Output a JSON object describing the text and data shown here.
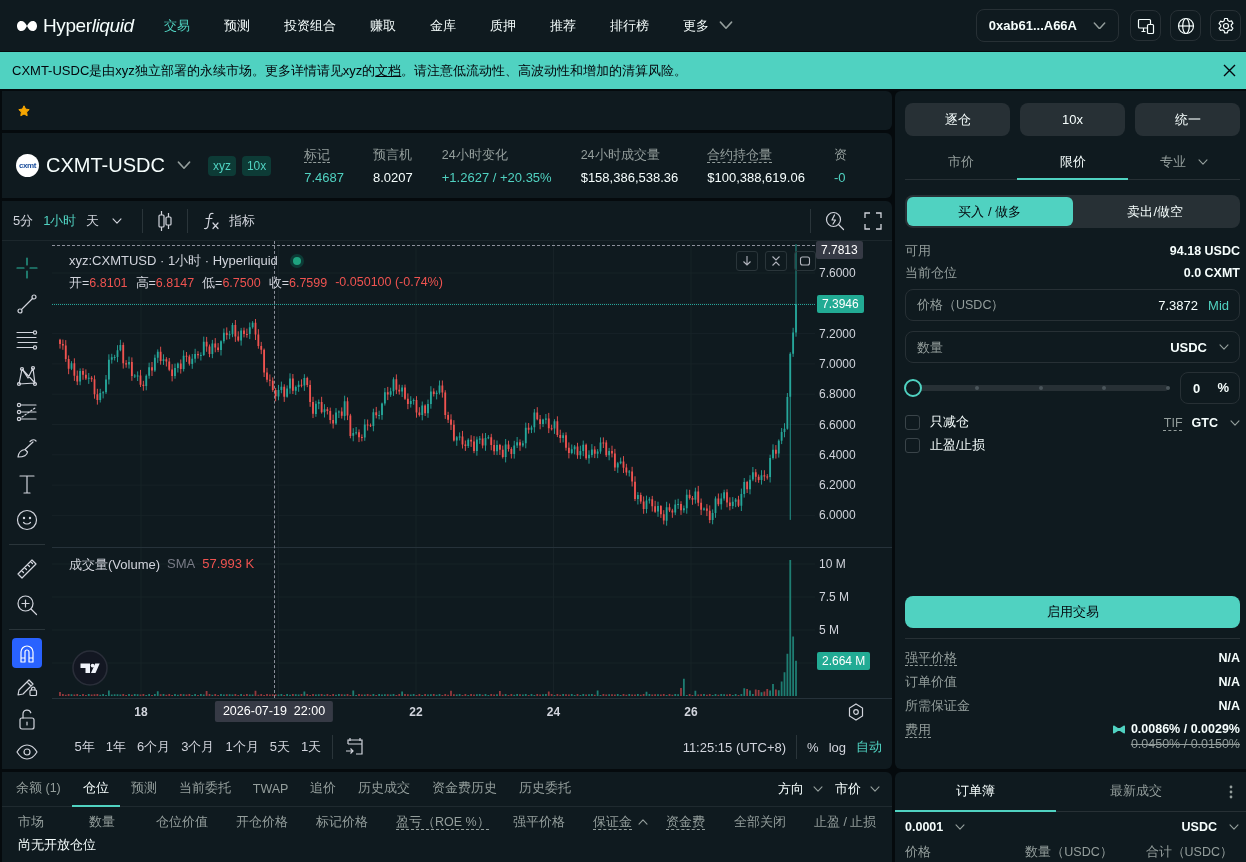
{
  "nav": {
    "brand": {
      "plain": "Hyper",
      "italic": "liquid"
    },
    "items": [
      {
        "label": "交易",
        "selected": true,
        "dropdown": false
      },
      {
        "label": "预测",
        "selected": false,
        "dropdown": false
      },
      {
        "label": "投资组合",
        "selected": false,
        "dropdown": false
      },
      {
        "label": "赚取",
        "selected": false,
        "dropdown": false
      },
      {
        "label": "金库",
        "selected": false,
        "dropdown": false
      },
      {
        "label": "质押",
        "selected": false,
        "dropdown": false
      },
      {
        "label": "推荐",
        "selected": false,
        "dropdown": false
      },
      {
        "label": "排行榜",
        "selected": false,
        "dropdown": false
      },
      {
        "label": "更多",
        "selected": false,
        "dropdown": true
      }
    ],
    "wallet": "0xab61...A66A"
  },
  "banner": {
    "text_before": "CXMT-USDC是由xyz独立部署的永续市场。更多详情请见xyz的",
    "link": "文档",
    "text_after": "。请注意低流动性、高波动性和增加的清算风险。"
  },
  "favorites": {
    "starred": true
  },
  "market": {
    "logo_text": "cxmt",
    "symbol": "CXMT-USDC",
    "badges": [
      "xyz",
      "10x"
    ],
    "stats": [
      {
        "label": "标记",
        "value": "7.4687",
        "accent": true,
        "dotted_underline": true
      },
      {
        "label": "预言机",
        "value": "8.0207",
        "accent": false,
        "dotted_underline": false
      },
      {
        "label": "24小时变化",
        "value": "+1.2627 / +20.35%",
        "accent": true,
        "dotted_underline": false
      },
      {
        "label": "24小时成交量",
        "value": "$158,386,538.36",
        "accent": false,
        "dotted_underline": false
      },
      {
        "label": "合约持仓量",
        "value": "$100,388,619.06",
        "accent": false,
        "dotted_underline": true
      },
      {
        "label": "资",
        "value": "-0",
        "accent": true,
        "dotted_underline": false
      }
    ]
  },
  "chart_toolbar": {
    "intervals": [
      {
        "label": "5分",
        "selected": false,
        "dropdown": false
      },
      {
        "label": "1小时",
        "selected": true,
        "dropdown": false
      },
      {
        "label": "天",
        "selected": false,
        "dropdown": true
      }
    ],
    "indicators": "指标"
  },
  "drawing_tools": [
    {
      "tools": [
        {
          "kind": "crosshair",
          "active": true
        },
        {
          "kind": "trendline",
          "active": false
        },
        {
          "kind": "hlines",
          "active": false
        },
        {
          "kind": "pattern",
          "active": false
        },
        {
          "kind": "fib",
          "active": false
        },
        {
          "kind": "brush",
          "active": false
        },
        {
          "kind": "text",
          "active": false
        },
        {
          "kind": "emoji",
          "active": false
        }
      ]
    },
    {
      "tools": [
        {
          "kind": "ruler",
          "active": false
        },
        {
          "kind": "zoom",
          "active": false
        }
      ]
    },
    {
      "tools": [
        {
          "kind": "magnet",
          "active": true
        },
        {
          "kind": "drawlock",
          "active": false
        },
        {
          "kind": "lock",
          "active": false
        },
        {
          "kind": "eye",
          "active": false
        }
      ]
    }
  ],
  "chart": {
    "title": "xyz:CXMTUSD · 1小时 · Hyperliquid",
    "live": true,
    "falling": true,
    "ohlc": [
      {
        "key": "开=",
        "value": "6.8101"
      },
      {
        "key": "高=",
        "value": "6.8147"
      },
      {
        "key": "低=",
        "value": "6.7500"
      },
      {
        "key": "收=",
        "value": "6.7599"
      }
    ],
    "change": "-0.050100 (-0.74%)",
    "crosshair_price": "7.7813",
    "price_axis": [
      "7.6000",
      "7.2000",
      "7.0000",
      "6.8000",
      "6.6000",
      "6.4000",
      "6.2000",
      "6.0000"
    ],
    "last_price": "7.3946",
    "volume_title": "成交量(Volume)",
    "volume_sma_label": "SMA",
    "volume_sma": "57.993 K",
    "volume_axis": [
      "10 M",
      "7.5 M",
      "5 M"
    ],
    "last_volume": "2.664 M",
    "time_axis": [
      "18",
      "22",
      "24",
      "26"
    ],
    "crosshair_time": "2026-07-19  22:00",
    "ranges": [
      "5年",
      "1年",
      "6个月",
      "3个月",
      "1个月",
      "5天",
      "1天"
    ],
    "clock": "11:25:15 (UTC+8)",
    "scale_modes": [
      {
        "label": "%",
        "selected": false
      },
      {
        "label": "log",
        "selected": false
      },
      {
        "label": "自动",
        "selected": true
      }
    ]
  },
  "positions": {
    "tabs": [
      {
        "label": "余额 (1)",
        "selected": false
      },
      {
        "label": "仓位",
        "selected": true
      },
      {
        "label": "预测",
        "selected": false
      },
      {
        "label": "当前委托",
        "selected": false
      },
      {
        "label": "TWAP",
        "selected": false
      },
      {
        "label": "追价",
        "selected": false
      },
      {
        "label": "历史成交",
        "selected": false
      },
      {
        "label": "资金费历史",
        "selected": false
      },
      {
        "label": "历史委托",
        "selected": false
      }
    ],
    "filters": [
      "方向",
      "市价"
    ],
    "columns": [
      {
        "label": "市场",
        "dotted_underline": false,
        "sorted": false
      },
      {
        "label": "数量",
        "dotted_underline": false,
        "sorted": false
      },
      {
        "label": "仓位价值",
        "dotted_underline": false,
        "sorted": false
      },
      {
        "label": "开仓价格",
        "dotted_underline": false,
        "sorted": false
      },
      {
        "label": "标记价格",
        "dotted_underline": false,
        "sorted": false
      },
      {
        "label": "盈亏（ROE %）",
        "dotted_underline": true,
        "sorted": false
      },
      {
        "label": "强平价格",
        "dotted_underline": false,
        "sorted": false
      },
      {
        "label": "保证金",
        "dotted_underline": true,
        "sorted": true
      },
      {
        "label": "资金费",
        "dotted_underline": true,
        "sorted": false
      },
      {
        "label": "全部关闭",
        "dotted_underline": false,
        "sorted": false
      },
      {
        "label": "止盈 / 止损",
        "dotted_underline": false,
        "sorted": false
      }
    ],
    "empty": "尚无开放仓位"
  },
  "order_form": {
    "margin_buttons": [
      "逐仓",
      "10x",
      "统一"
    ],
    "order_types": [
      {
        "label": "市价",
        "selected": false,
        "dropdown": false
      },
      {
        "label": "限价",
        "selected": true,
        "dropdown": false
      },
      {
        "label": "专业",
        "selected": false,
        "dropdown": true
      }
    ],
    "sides": [
      {
        "label": "买入 / 做多",
        "selected": true
      },
      {
        "label": "卖出/做空",
        "selected": false
      }
    ],
    "balances": [
      {
        "label": "可用",
        "value": "94.18 USDC"
      },
      {
        "label": "当前仓位",
        "value": "0.0 CXMT"
      }
    ],
    "price_field": {
      "label": "价格（USDC）",
      "value": "7.3872",
      "action": "Mid"
    },
    "size_field": {
      "placeholder": "数量",
      "unit": "USDC"
    },
    "size_slider": {
      "level": 0
    },
    "percent_field": {
      "value": "0",
      "unit": "%"
    },
    "options": [
      {
        "label": "只减仓",
        "checked": false
      },
      {
        "label": "止盈/止损",
        "checked": false
      }
    ],
    "tif": {
      "label": "TIF",
      "value": "GTC"
    },
    "submit": "启用交易",
    "summary": [
      {
        "label": "强平价格",
        "value": "N/A",
        "dotted_underline": true
      },
      {
        "label": "订单价值",
        "value": "N/A",
        "dotted_underline": false
      },
      {
        "label": "所需保证金",
        "value": "N/A",
        "dotted_underline": false
      },
      {
        "label": "费用",
        "value": "0.0086% / 0.0029%",
        "previous": "0.0450% / 0.0150%",
        "dotted_underline": true
      }
    ]
  },
  "order_book": {
    "tabs": [
      {
        "label": "订单簿",
        "selected": true
      },
      {
        "label": "最新成交",
        "selected": false
      }
    ],
    "tick_size": "0.0001",
    "unit": "USDC",
    "columns": [
      "价格",
      "数量（USDC）",
      "合计（USDC）"
    ]
  }
}
